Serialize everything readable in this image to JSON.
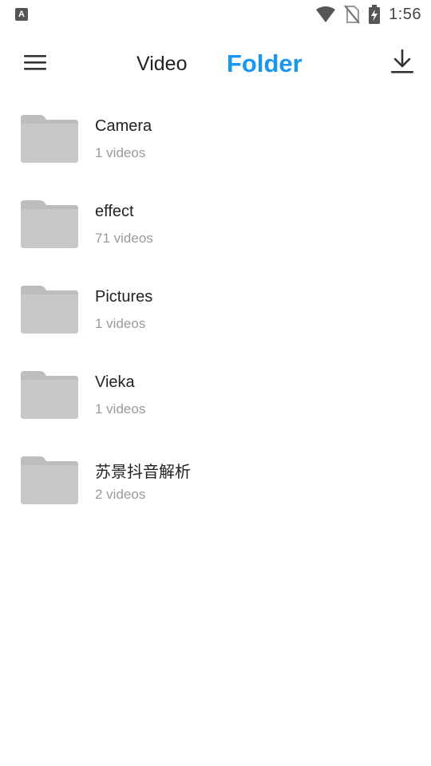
{
  "status_bar": {
    "notification_icon": "a-letter-icon",
    "notification_letter": "A",
    "wifi_icon": "wifi-icon",
    "sim_icon": "no-sim-icon",
    "battery_icon": "battery-charging-icon",
    "time": "1:56"
  },
  "toolbar": {
    "menu_icon": "hamburger-menu-icon",
    "tabs": [
      {
        "label": "Video",
        "active": false
      },
      {
        "label": "Folder",
        "active": true
      }
    ],
    "download_icon": "download-icon",
    "active_color": "#1a96ee"
  },
  "folders": [
    {
      "name": "Camera",
      "count": "1 videos"
    },
    {
      "name": "effect",
      "count": "71 videos"
    },
    {
      "name": "Pictures",
      "count": "1 videos"
    },
    {
      "name": "Vieka",
      "count": "1 videos"
    },
    {
      "name": "苏景抖音解析",
      "count": "2 videos"
    }
  ]
}
